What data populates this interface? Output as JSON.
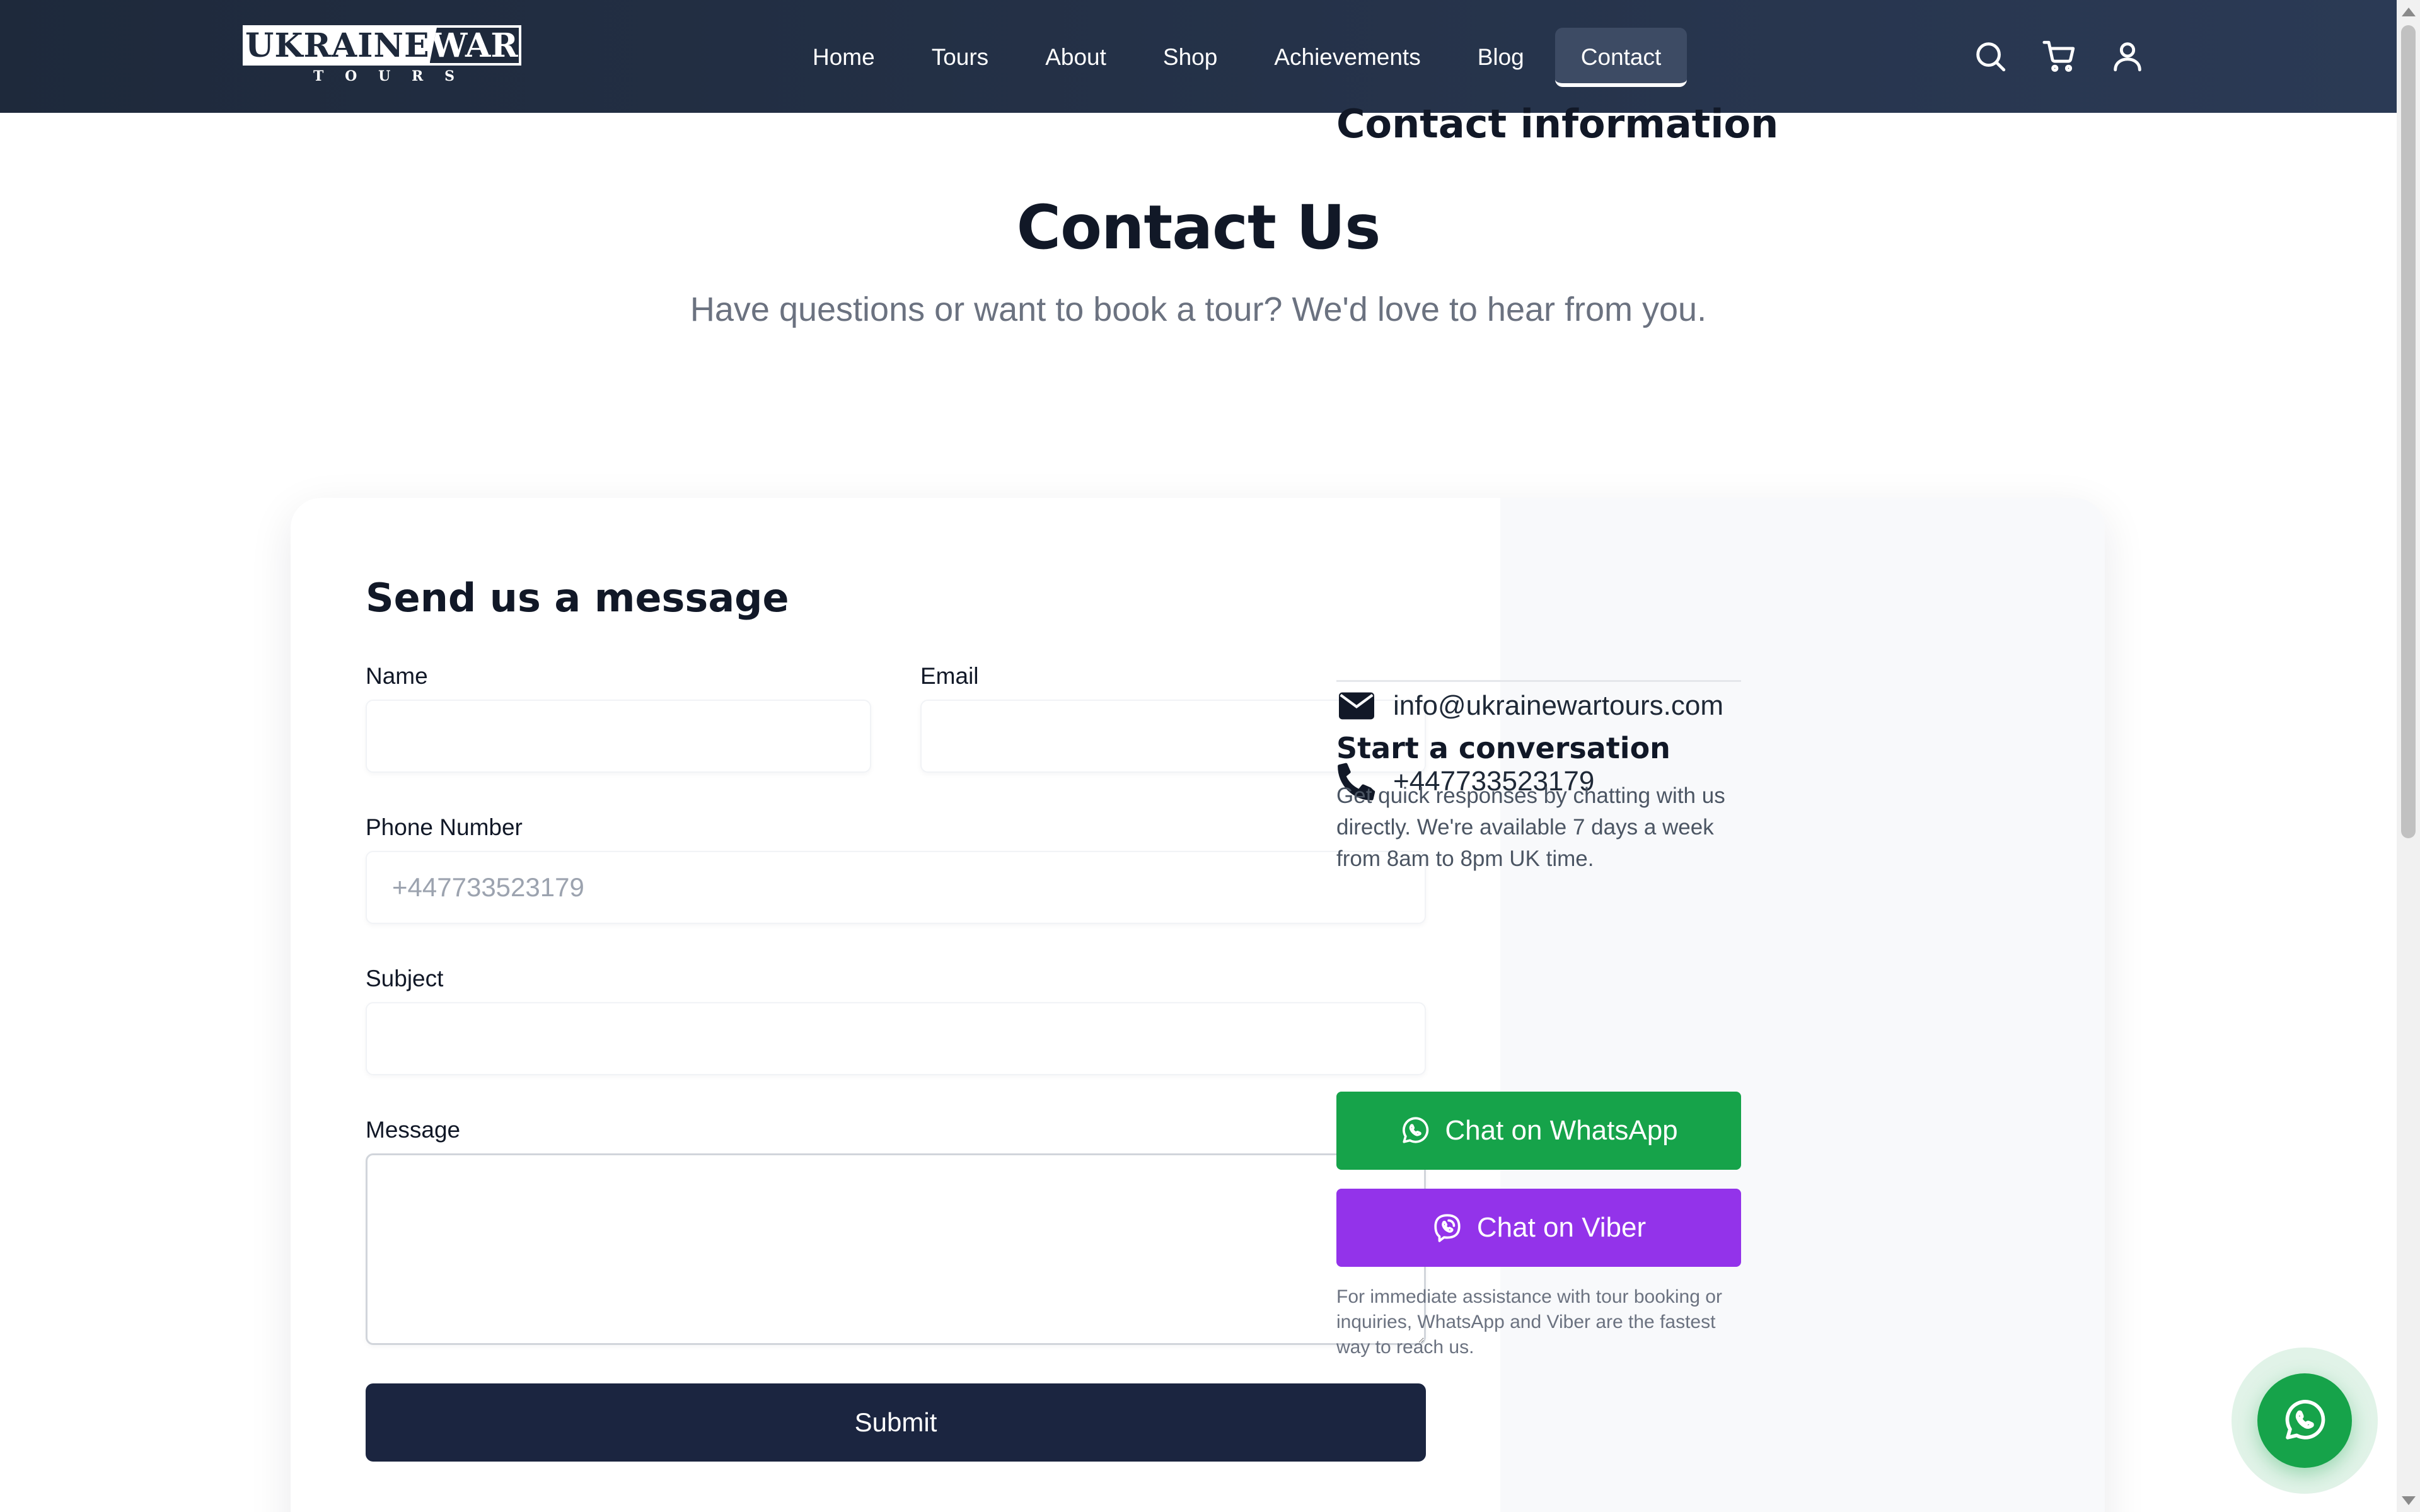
{
  "header": {
    "logo": {
      "word1": "UKRAINE",
      "word2": "WAR",
      "tagline_letters": [
        "T",
        "O",
        "U",
        "R",
        "S"
      ]
    },
    "nav": [
      {
        "label": "Home",
        "active": false
      },
      {
        "label": "Tours",
        "active": false
      },
      {
        "label": "About",
        "active": false
      },
      {
        "label": "Shop",
        "active": false
      },
      {
        "label": "Achievements",
        "active": false
      },
      {
        "label": "Blog",
        "active": false
      },
      {
        "label": "Contact",
        "active": true
      }
    ],
    "icons": [
      "search-icon",
      "cart-icon",
      "user-icon"
    ]
  },
  "hero": {
    "title": "Contact Us",
    "subtitle": "Have questions or want to book a tour? We'd love to hear from you."
  },
  "form": {
    "title": "Send us a message",
    "name_label": "Name",
    "name_value": "",
    "email_label": "Email",
    "email_value": "",
    "phone_label": "Phone Number",
    "phone_placeholder": "+447733523179",
    "subject_label": "Subject",
    "subject_value": "",
    "message_label": "Message",
    "message_value": "",
    "submit_label": "Submit"
  },
  "contact_info": {
    "title": "Contact information",
    "email": "info@ukrainewartours.com",
    "phone": "+447733523179",
    "conversation_title": "Start a conversation",
    "conversation_text": "Get quick responses by chatting with us directly. We're available 7 days a week from 8am to 8pm UK time.",
    "whatsapp_label": "Chat on WhatsApp",
    "viber_label": "Chat on Viber",
    "note": "For immediate assistance with tour booking or inquiries, WhatsApp and Viber are the fastest way to reach us."
  },
  "colors": {
    "header_bg": "#1e293b",
    "primary_dark": "#1b2540",
    "whatsapp_green": "#16a34a",
    "viber_purple": "#9333ea",
    "muted_text": "#6b7280"
  }
}
